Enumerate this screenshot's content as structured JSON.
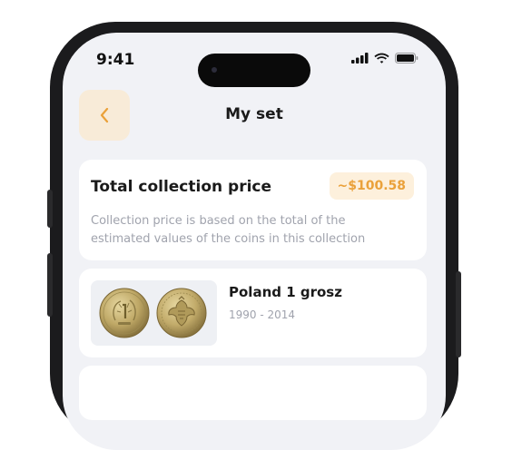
{
  "status_bar": {
    "time": "9:41"
  },
  "header": {
    "back_icon": "chevron-left-icon",
    "title": "My set"
  },
  "total_card": {
    "title": "Total collection price",
    "price": "~$100.58",
    "description": "Collection price is based on the total of the estimated values of the coins in this collection"
  },
  "coins": [
    {
      "name": "Poland 1 grosz",
      "years": "1990 - 2014"
    }
  ],
  "colors": {
    "accent": "#eaa13a",
    "accent_bg": "#fdf0dc",
    "back_bg": "#f8ebd8",
    "screen_bg": "#f1f2f6",
    "muted_text": "#a0a3ad"
  }
}
